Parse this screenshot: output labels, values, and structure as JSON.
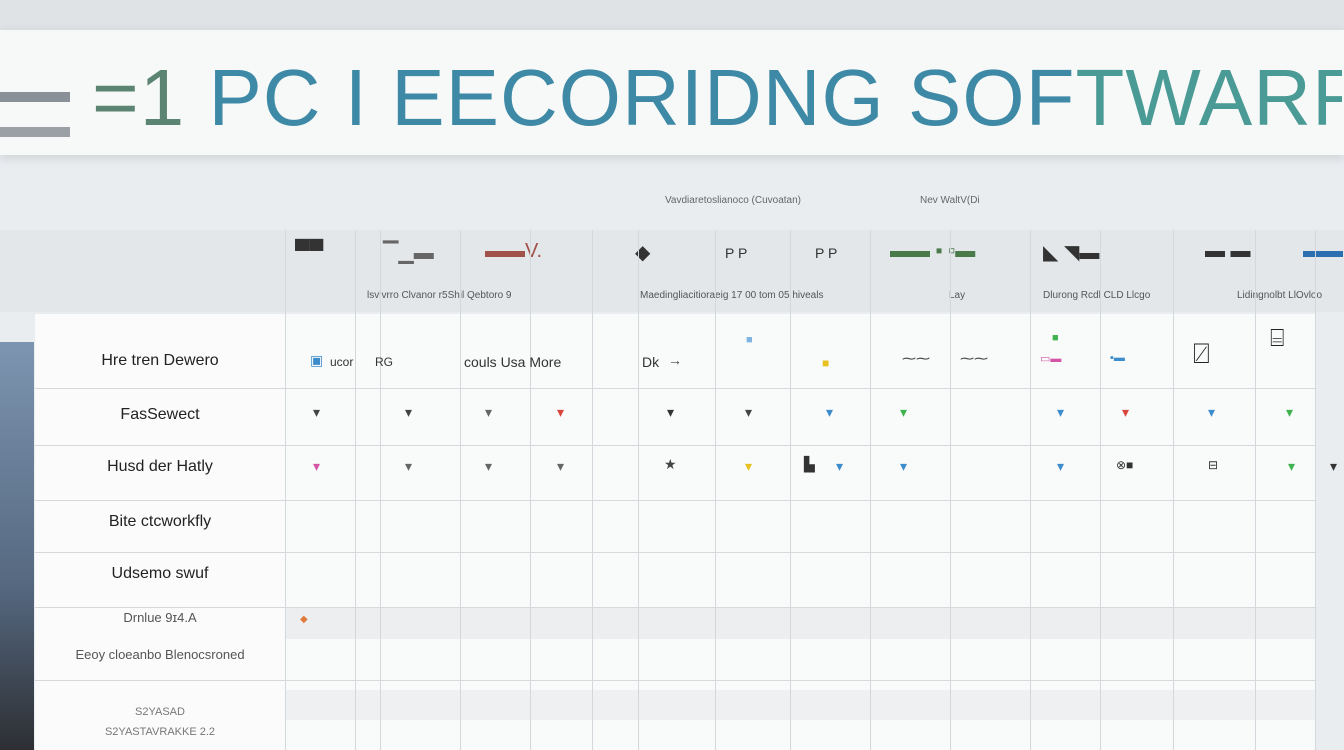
{
  "banner": {
    "prefix": "=1",
    "title": " PC I EECORIDNG SOF",
    "suffix": "TWARRT"
  },
  "sub_headers": [
    "Vavdiaretoslianoco (Cuvoatan)",
    "Nev WaltV(Di"
  ],
  "group_labels": [
    "lsvlvrro Clvanor r5Shil Qebtoro 9",
    "Maedingliacitioraeig 17 00 tom 05 hiveals",
    "Lay",
    "Dlurong Rcdl CLD Llcgo",
    "Lidingnolbt LlOvloo"
  ],
  "row_labels": [
    "Hre tren Dewero",
    "FasSewect",
    "Husd der Hatly",
    "Bite ctcworkfly",
    "Udsemo swuf",
    "Drnlue 9ɪ4.A",
    "Eeoy cloeanbo Blenocsroned",
    "S2YASAD",
    "S2YASTAVRAKKE 2.2"
  ],
  "row1_texts": [
    "ucor",
    "RG",
    "couls Usa More",
    "Dk"
  ],
  "colors": {
    "banner_text": "#3e8aa6",
    "banner_accent": "#5b8472",
    "check_dark": "#444",
    "check_red": "#d9453d",
    "check_blue": "#3d8ccc",
    "check_green": "#3fb34f",
    "check_yellow": "#e8c11f",
    "check_pink": "#d455a5"
  }
}
